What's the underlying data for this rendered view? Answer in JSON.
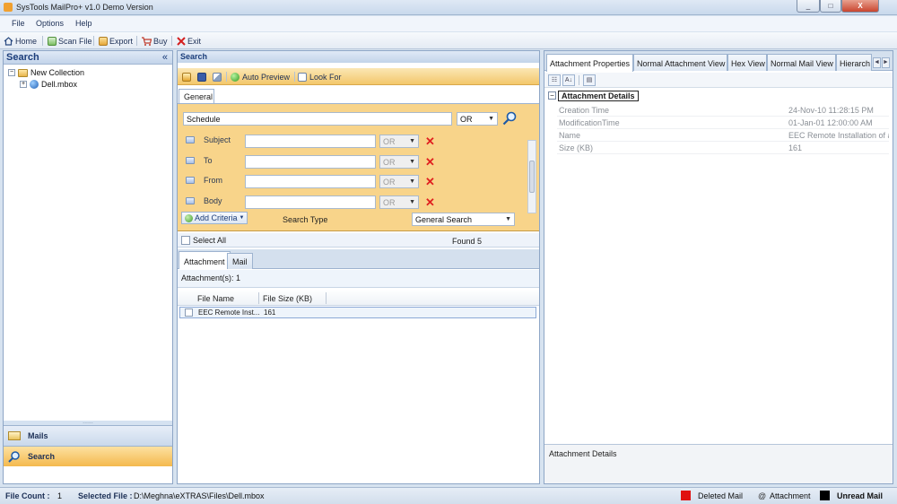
{
  "window": {
    "title": "SysTools MailPro+ v1.0 Demo Version",
    "min": "_",
    "max": "□",
    "close": "X"
  },
  "menu": [
    "File",
    "Options",
    "Help"
  ],
  "toolbar": {
    "home": "Home",
    "scan": "Scan File",
    "export": "Export",
    "buy": "Buy",
    "exit": "Exit"
  },
  "left": {
    "header": "Search",
    "collapse": "«",
    "tree": {
      "collection": "New Collection",
      "file": "Dell.mbox",
      "expand": "+"
    },
    "grip": "......",
    "nav": {
      "mails": "Mails",
      "search": "Search"
    }
  },
  "center": {
    "header": "Search",
    "toolbar": {
      "auto_preview": "Auto Preview",
      "look_for": "Look For"
    },
    "tab": "General",
    "criteria": {
      "main_value": "Schedule",
      "main_op": "OR",
      "rows": [
        {
          "label": "Subject",
          "op": "OR"
        },
        {
          "label": "To",
          "op": "OR"
        },
        {
          "label": "From",
          "op": "OR"
        },
        {
          "label": "Body",
          "op": "OR"
        }
      ],
      "add_criteria": "Add Criteria",
      "search_type_label": "Search Type",
      "search_type_value": "General Search"
    },
    "select_all": "Select All",
    "found": "Found  5",
    "subtabs": {
      "attachment": "Attachment",
      "mail": "Mail"
    },
    "attachment_count": "Attachment(s):  1",
    "grid": {
      "columns": [
        "File Name",
        "File Size (KB)"
      ],
      "rows": [
        {
          "name": "EEC Remote Inst...",
          "size": "161"
        }
      ]
    }
  },
  "right": {
    "tabs": [
      "Attachment Properties",
      "Normal Attachment View",
      "Hex View",
      "Normal Mail View",
      "Hierarch"
    ],
    "section": "Attachment Details",
    "collapse": "−",
    "properties": [
      {
        "key": "Creation Time",
        "value": "24-Nov-10 11:28:15 PM"
      },
      {
        "key": "ModificationTime",
        "value": "01-Jan-01 12:00:00 AM"
      },
      {
        "key": "Name",
        "value": "EEC Remote Installation of an"
      },
      {
        "key": "Size (KB)",
        "value": "161"
      }
    ],
    "detail_label": "Attachment Details",
    "nav_prev": "◄",
    "nav_next": "►"
  },
  "status": {
    "file_count_label": "File Count :",
    "file_count": "1",
    "selected_label": "Selected File :",
    "selected_path": "D:\\Meghna\\eXTRAS\\Files\\Dell.mbox",
    "legend": {
      "deleted": "Deleted Mail",
      "attachment": "Attachment",
      "unread": "Unread Mail"
    },
    "colors": {
      "deleted": "#e01010",
      "unread": "#000000"
    }
  }
}
